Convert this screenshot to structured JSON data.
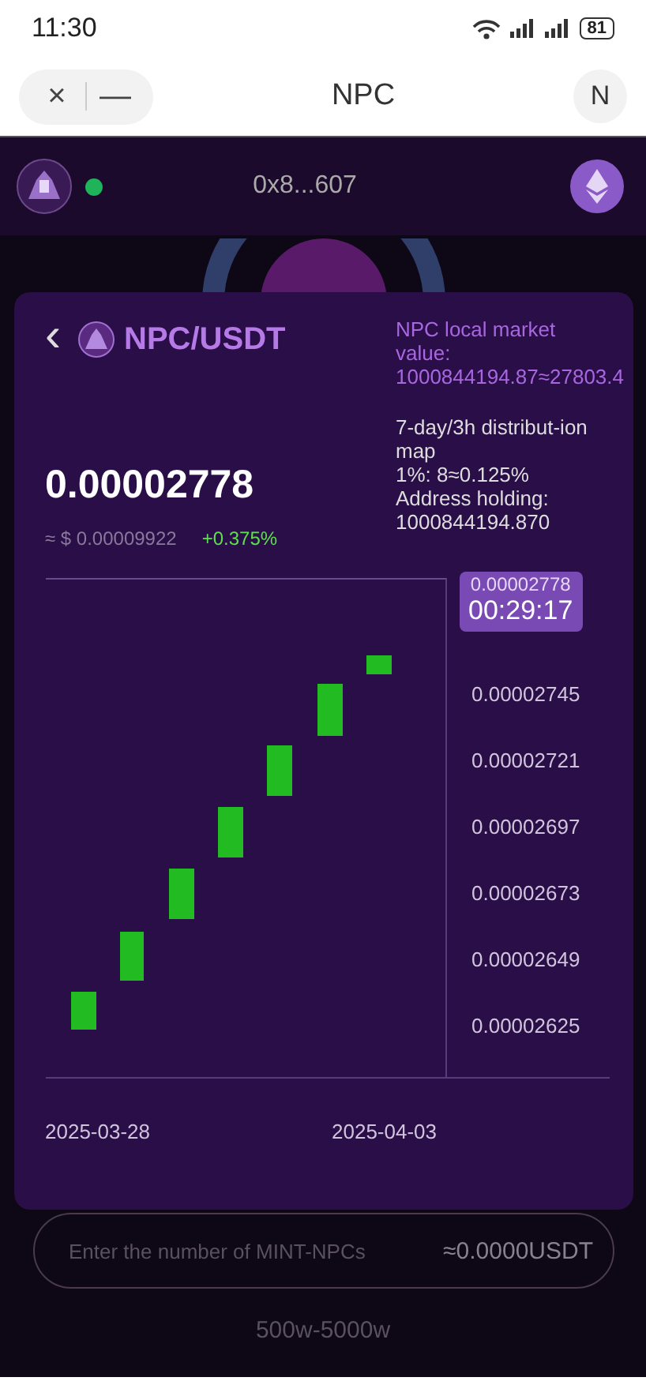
{
  "status_bar": {
    "time": "11:30",
    "battery": "81"
  },
  "browser_bar": {
    "close_glyph": "×",
    "minimize_glyph": "—",
    "title": "NPC",
    "account_letter": "N"
  },
  "app_bar": {
    "address": "0x8...607",
    "connected": true
  },
  "pair": {
    "back_glyph": "‹",
    "title": "NPC/USDT",
    "price": "0.00002778",
    "usd_price": "≈ $ 0.00009922",
    "change": "+0.375%"
  },
  "info": [
    {
      "kind": "accent",
      "text": "NPC local market value:"
    },
    {
      "kind": "accent",
      "text": "1000844194.87≈27803.4"
    },
    {
      "kind": "section",
      "text": "7-day/3h distribut-ion map"
    },
    {
      "kind": "plain",
      "text": "1%:  8≈0.125%"
    },
    {
      "kind": "plain",
      "text": "Address holding: 1000844194.870"
    }
  ],
  "chart": {
    "current_price": "0.00002778",
    "current_time": "00:29:17",
    "y_labels": [
      "0.00002745",
      "0.00002721",
      "0.00002697",
      "0.00002673",
      "0.00002649",
      "0.00002625"
    ],
    "x_labels": [
      "2025-03-28",
      "2025-04-03"
    ]
  },
  "mint": {
    "placeholder": "Enter the number of MINT-NPCs",
    "estimate": "≈0.0000USDT",
    "range": "500w-5000w"
  }
}
